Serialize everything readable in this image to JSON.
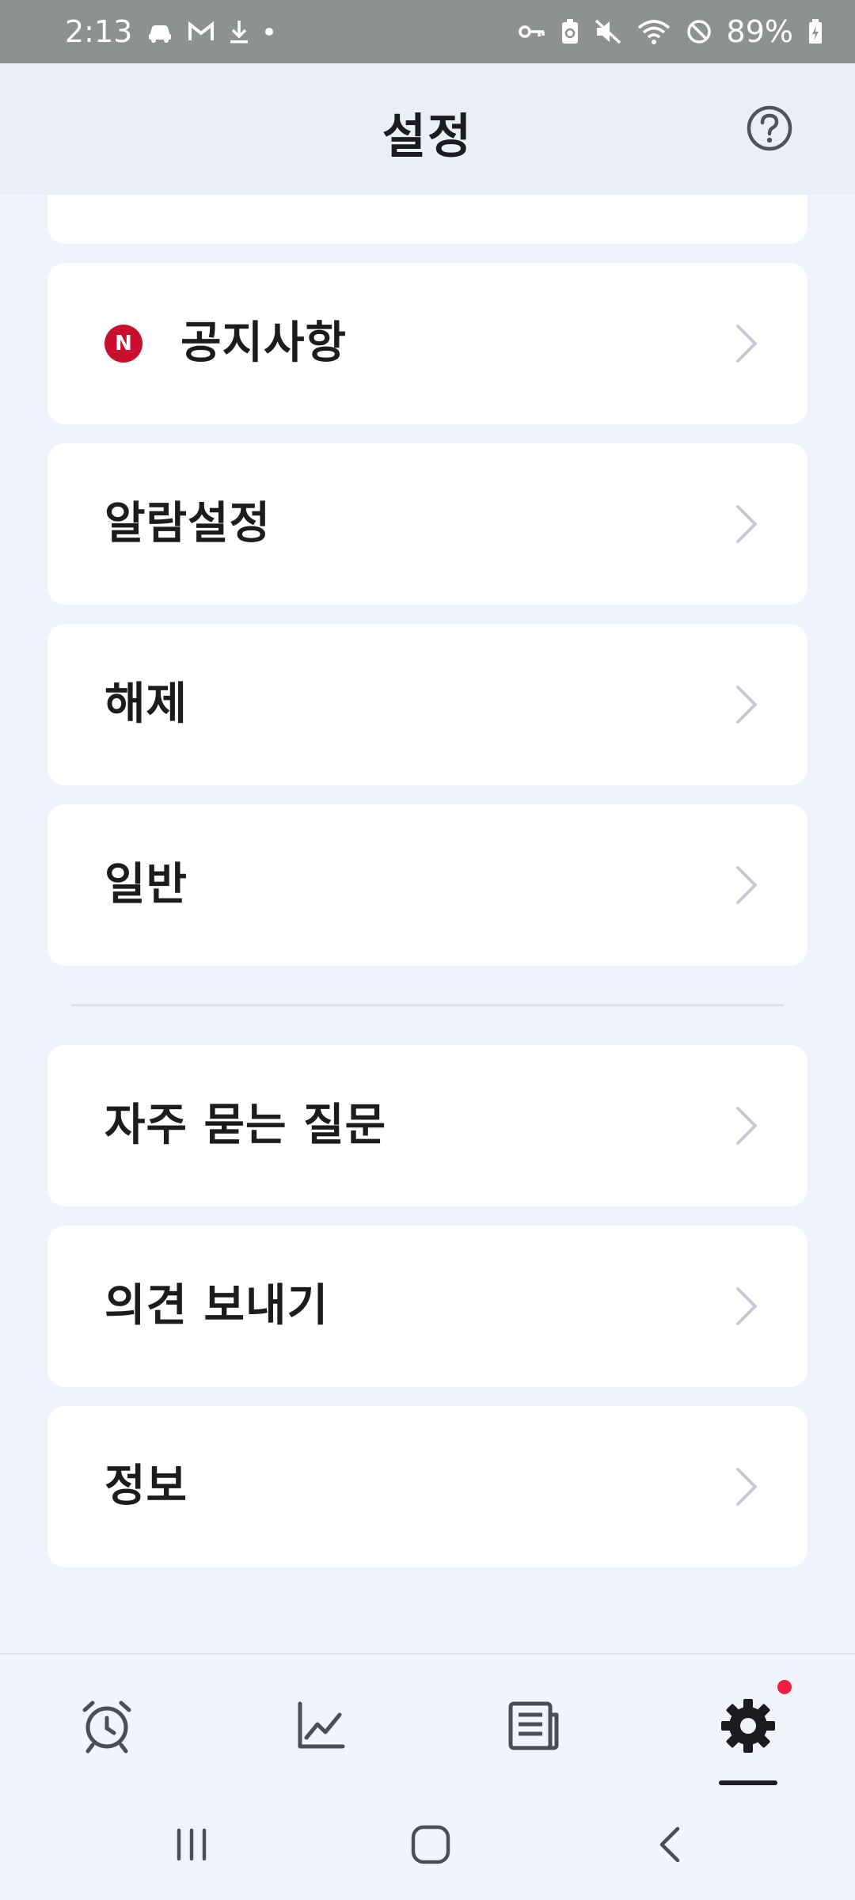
{
  "status_bar": {
    "time": "2:13",
    "battery": "89%",
    "left_icons": [
      "car-icon",
      "gmail-icon",
      "download-icon",
      "dot-icon"
    ],
    "right_icons": [
      "key-icon",
      "battery-saver-icon",
      "mute-icon",
      "wifi-icon",
      "do-not-disturb-icon",
      "battery-icon"
    ]
  },
  "header": {
    "title": "설정",
    "help_icon": "question-circle-icon"
  },
  "menu": {
    "notice": {
      "label": "공지사항",
      "badge": "N"
    },
    "alarm_settings": {
      "label": "알람설정"
    },
    "release": {
      "label": "해제"
    },
    "general": {
      "label": "일반"
    },
    "faq": {
      "label": "자주 묻는 질문"
    },
    "feedback": {
      "label": "의견 보내기"
    },
    "info": {
      "label": "정보"
    }
  },
  "bottom_nav": {
    "items": [
      "alarm-clock-icon",
      "chart-icon",
      "news-icon",
      "settings-icon"
    ],
    "active": "settings-icon",
    "badge_color": "#ef1f3f"
  },
  "system_nav": [
    "recents-icon",
    "home-icon",
    "back-icon"
  ],
  "colors": {
    "background": "#eff3fb",
    "card": "#ffffff",
    "badge": "#c8102e",
    "chevron": "#c5cad4",
    "text": "#1c1c1e"
  }
}
